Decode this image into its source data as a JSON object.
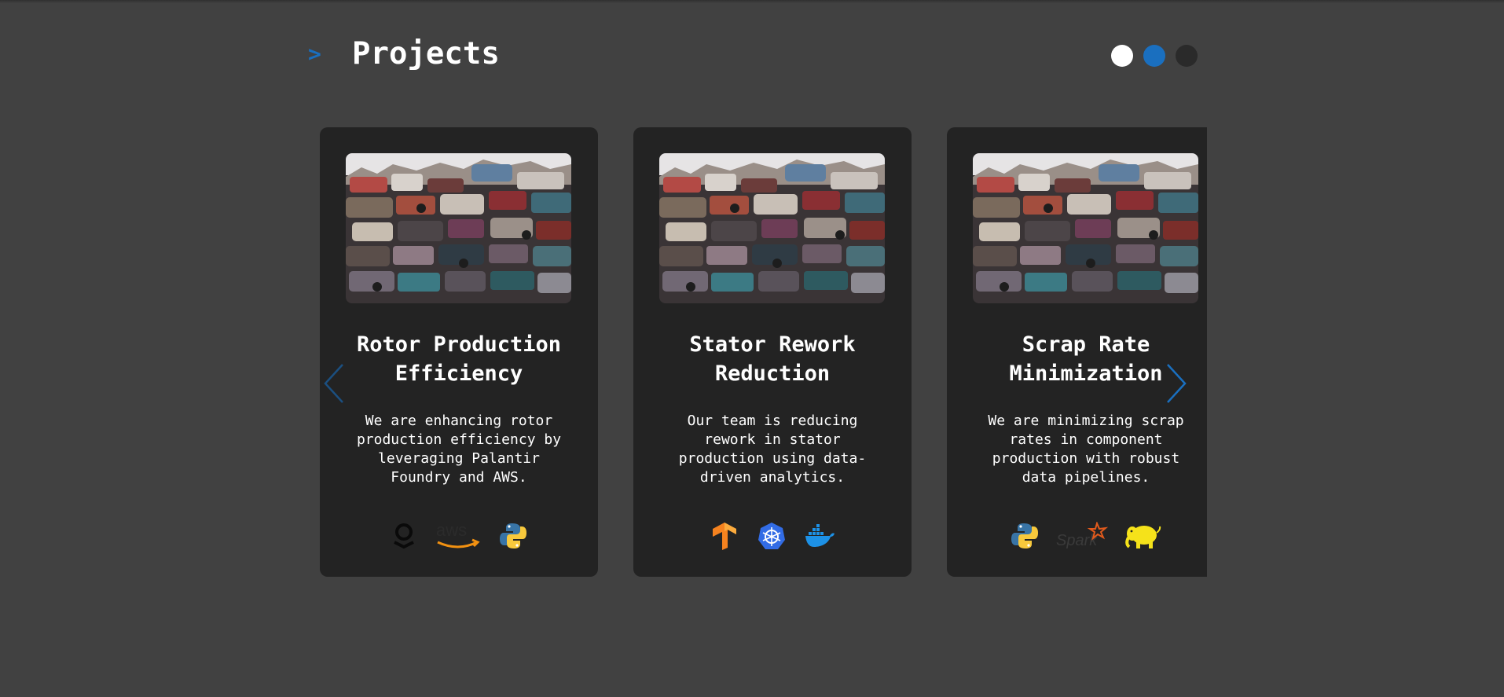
{
  "header": {
    "prompt_symbol": ">",
    "title": "Projects"
  },
  "pagination": {
    "dots": [
      {
        "color": "#ffffff",
        "active": false
      },
      {
        "color": "#1a6fbf",
        "active": true
      },
      {
        "color": "#2a2a2a",
        "active": false
      }
    ]
  },
  "colors": {
    "background": "#414141",
    "card": "#232323",
    "accent": "#1a6fbf"
  },
  "projects": [
    {
      "title": "Rotor Production Efficiency",
      "description": "We are enhancing rotor production efficiency by leveraging Palantir Foundry and AWS.",
      "image": "scrap-car-pile-image",
      "tech": [
        "palantir-icon",
        "aws-icon",
        "python-icon"
      ]
    },
    {
      "title": "Stator Rework Reduction",
      "description": "Our team is reducing rework in stator production using data-driven analytics.",
      "image": "scrap-car-pile-image",
      "tech": [
        "tensorflow-icon",
        "kubernetes-icon",
        "docker-icon"
      ]
    },
    {
      "title": "Scrap Rate Minimization",
      "description": "We are minimizing scrap rates in component production with robust data pipelines.",
      "image": "scrap-car-pile-image",
      "tech": [
        "python-icon",
        "spark-icon",
        "hadoop-icon"
      ],
      "tech_labels": {
        "spark": "Spark"
      }
    }
  ],
  "navigation": {
    "prev": "chevron-left-icon",
    "next": "chevron-right-icon"
  }
}
